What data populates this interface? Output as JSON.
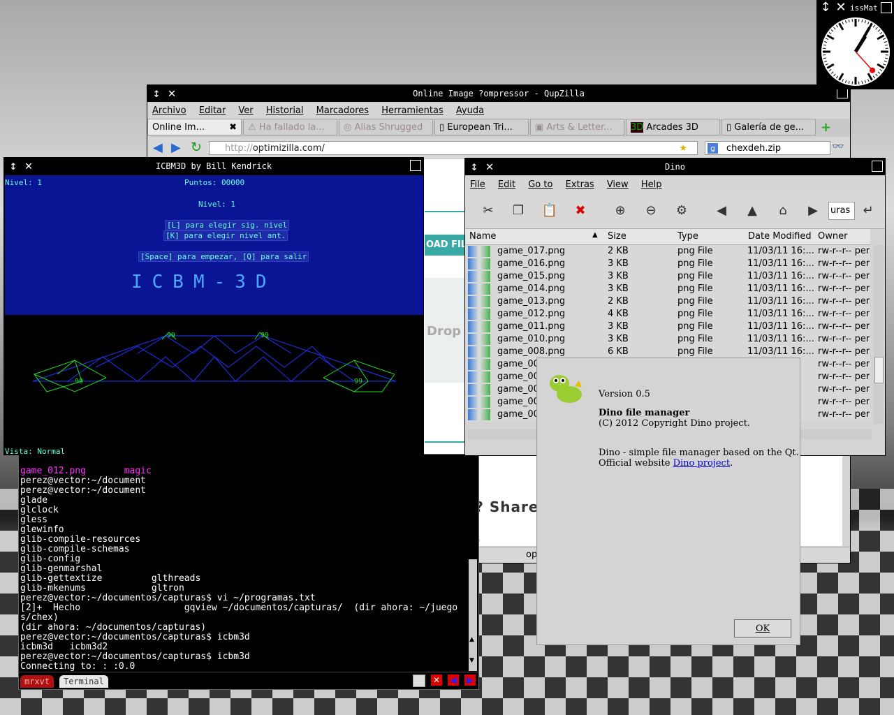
{
  "browser": {
    "title": "Online Image ?ompressor - QupZilla",
    "menu": [
      "Archivo",
      "Editar",
      "Ver",
      "Historial",
      "Marcadores",
      "Herramientas",
      "Ayuda"
    ],
    "tabs": [
      {
        "label": "Online Im..."
      },
      {
        "label": "Ha fallado la..."
      },
      {
        "label": "Alias Shrugged"
      },
      {
        "label": "European Tri..."
      },
      {
        "label": "Arts & Letter..."
      },
      {
        "label": "Arcades 3D"
      },
      {
        "label": "Galería de ge..."
      }
    ],
    "url_prefix": "http://",
    "url_host": "optimizilla.com/",
    "search_value": "chexdeh.zip",
    "page_snippets": {
      "load_files": "OAD FIL",
      "drop": "Drop",
      "like_share": "Like it? Share",
      "status": "op"
    }
  },
  "icbm": {
    "title": "ICBM3D by Bill Kendrick",
    "nivel_top": "Nivel: 1",
    "puntos": "Puntos: 00000",
    "nivel_center": "Nivel: 1",
    "help_l": "[L] para elegir sig. nivel",
    "help_k": "[K] para elegir nivel ant.",
    "help_space": "[Space] para empezar, [Q] para salir",
    "logo": "ICBM-3D",
    "base_labels": [
      "99",
      "99",
      "99",
      "99"
    ],
    "vista": "Vista: Normal"
  },
  "terminal": {
    "lines": [
      "game_012.png       magic",
      "perez@vector:~/document",
      "perez@vector:~/document",
      "glade",
      "glclock",
      "gless",
      "glewinfo",
      "glib-compile-resources",
      "glib-compile-schemas",
      "glib-config",
      "glib-genmarshal",
      "glib-gettextize         glthreads",
      "glib-mkenums            gltron",
      "perez@vector:~/documentos/capturas$ vi ~/programas.txt",
      "[2]+  Hecho                   gqview ~/documentos/capturas/  (dir ahora: ~/juego",
      "s/chex)",
      "(dir ahora: ~/documentos/capturas)",
      "perez@vector:~/documentos/capturas$ icbm3d",
      "icbm3d   icbm3d2",
      "perez@vector:~/documentos/capturas$ icbm3d",
      "Connecting to: : :0.0"
    ],
    "tabs": [
      "mrxvt",
      "Terminal"
    ]
  },
  "dino": {
    "title": "Dino",
    "menu": [
      "File",
      "Edit",
      "Go to",
      "Extras",
      "View",
      "Help"
    ],
    "path_value": "uras",
    "columns": [
      "Name",
      "Size",
      "Type",
      "Date Modified",
      "Owner"
    ],
    "rows": [
      {
        "name": "game_017.png",
        "size": "2 KB",
        "type": "png File",
        "date": "11/03/11 16:...",
        "owner": "rw-r--r-- per"
      },
      {
        "name": "game_016.png",
        "size": "3 KB",
        "type": "png File",
        "date": "11/03/11 16:...",
        "owner": "rw-r--r-- per"
      },
      {
        "name": "game_015.png",
        "size": "3 KB",
        "type": "png File",
        "date": "11/03/11 16:...",
        "owner": "rw-r--r-- per"
      },
      {
        "name": "game_014.png",
        "size": "3 KB",
        "type": "png File",
        "date": "11/03/11 16:...",
        "owner": "rw-r--r-- per"
      },
      {
        "name": "game_013.png",
        "size": "2 KB",
        "type": "png File",
        "date": "11/03/11 16:...",
        "owner": "rw-r--r-- per"
      },
      {
        "name": "game_012.png",
        "size": "4 KB",
        "type": "png File",
        "date": "11/03/11 16:...",
        "owner": "rw-r--r-- per"
      },
      {
        "name": "game_011.png",
        "size": "3 KB",
        "type": "png File",
        "date": "11/03/11 16:...",
        "owner": "rw-r--r-- per"
      },
      {
        "name": "game_010.png",
        "size": "3 KB",
        "type": "png File",
        "date": "11/03/11 16:...",
        "owner": "rw-r--r-- per"
      },
      {
        "name": "game_008.png",
        "size": "6 KB",
        "type": "png File",
        "date": "11/03/11 16:...",
        "owner": "rw-r--r-- per"
      },
      {
        "name": "game_00",
        "size": "",
        "type": "",
        "date": "16:...",
        "owner": "rw-r--r-- per"
      },
      {
        "name": "game_00",
        "size": "",
        "type": "",
        "date": "16:...",
        "owner": "rw-r--r-- per"
      },
      {
        "name": "game_00",
        "size": "",
        "type": "",
        "date": "16:...",
        "owner": "rw-r--r-- per"
      },
      {
        "name": "game_00",
        "size": "",
        "type": "",
        "date": "16:...",
        "owner": "rw-r--r-- per"
      },
      {
        "name": "game_00",
        "size": "",
        "type": "",
        "date": "16:...",
        "owner": "rw-r--r-- per"
      }
    ]
  },
  "about": {
    "version": "Version 0.5",
    "app_name": "Dino file manager",
    "copyright": "(C) 2012 Copyright Dino project.",
    "description": "Dino - simple file manager based on the Qt.",
    "website_prefix": "Official website ",
    "website_link": "Dino project",
    "website_suffix": ".",
    "ok_label": "OK"
  },
  "clock": {
    "title": "issMat",
    "hour": 1,
    "minute": 5,
    "second": 23
  }
}
